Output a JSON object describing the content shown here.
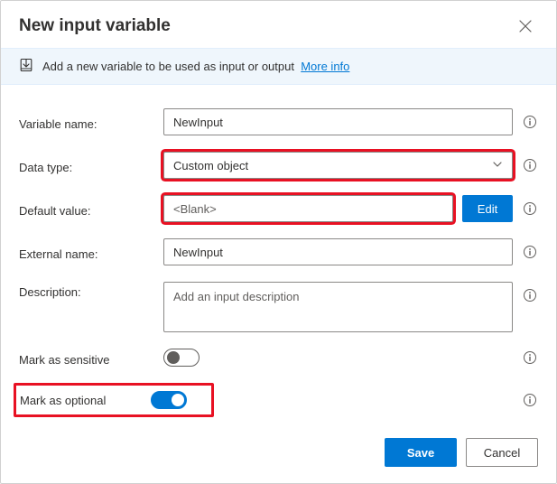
{
  "header": {
    "title": "New input variable"
  },
  "infoBar": {
    "text": "Add a new variable to be used as input or output",
    "link": "More info"
  },
  "fields": {
    "variableName": {
      "label": "Variable name:",
      "value": "NewInput"
    },
    "dataType": {
      "label": "Data type:",
      "value": "Custom object"
    },
    "defaultValue": {
      "label": "Default value:",
      "value": "<Blank>",
      "edit": "Edit"
    },
    "externalName": {
      "label": "External name:",
      "value": "NewInput"
    },
    "description": {
      "label": "Description:",
      "placeholder": "Add an input description"
    },
    "sensitive": {
      "label": "Mark as sensitive",
      "value": false
    },
    "optional": {
      "label": "Mark as optional",
      "value": true
    }
  },
  "footer": {
    "save": "Save",
    "cancel": "Cancel"
  }
}
